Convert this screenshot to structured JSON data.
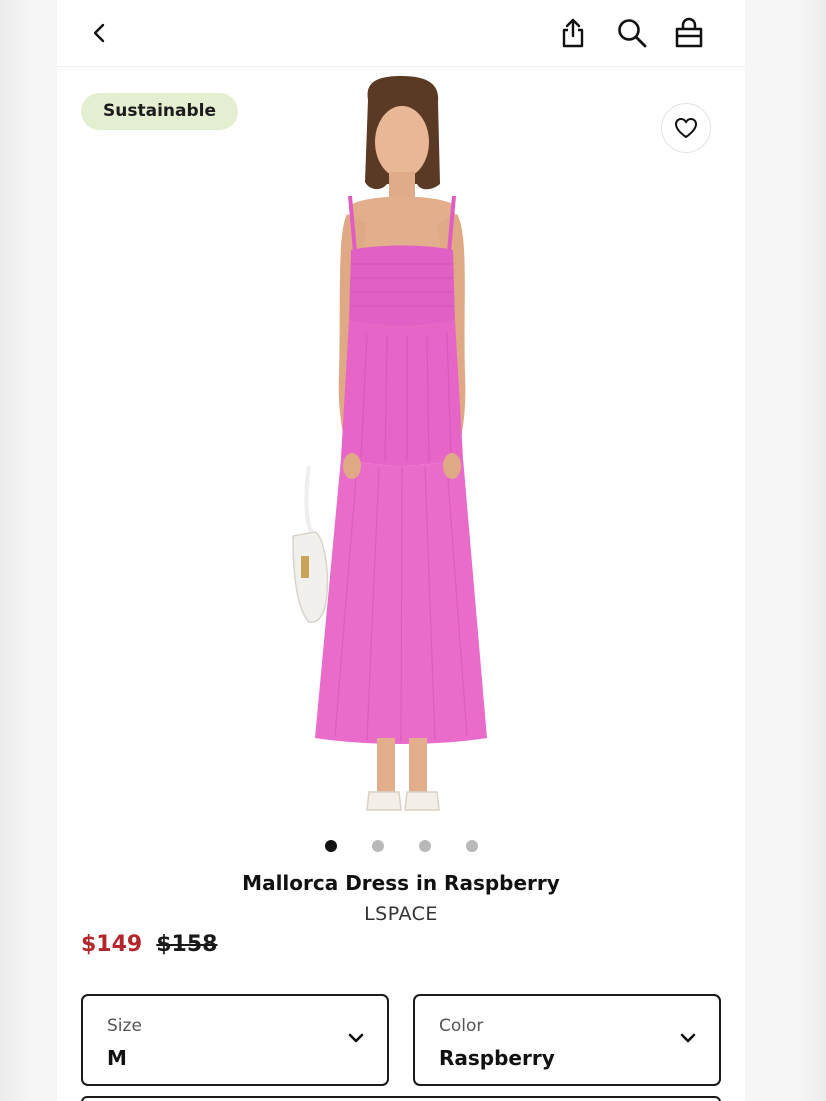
{
  "header": {
    "back_icon": "chevron-left-icon",
    "share_icon": "share-icon",
    "search_icon": "search-icon",
    "bag_icon": "shopping-bag-icon"
  },
  "badge": {
    "label": "Sustainable"
  },
  "favorite": {
    "icon": "heart-icon"
  },
  "gallery": {
    "total_images": 4,
    "active_index": 0
  },
  "product": {
    "name": "Mallorca Dress in Raspberry",
    "brand": "LSPACE",
    "sale_price": "$149",
    "original_price": "$158"
  },
  "selectors": {
    "size": {
      "label": "Size",
      "value": "M"
    },
    "color": {
      "label": "Color",
      "value": "Raspberry"
    }
  },
  "colors": {
    "sale_price": "#b3262c",
    "badge_bg": "#e4eed1",
    "dress": "#e865c8"
  }
}
